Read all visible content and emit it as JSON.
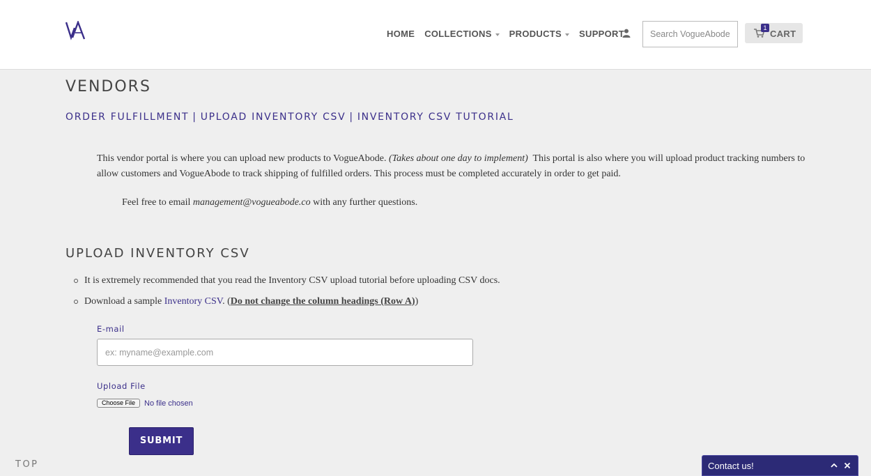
{
  "header": {
    "logo_alt": "VA",
    "nav": [
      {
        "label": "HOME",
        "dropdown": false
      },
      {
        "label": "COLLECTIONS",
        "dropdown": true
      },
      {
        "label": "PRODUCTS",
        "dropdown": true
      },
      {
        "label": "SUPPORT",
        "dropdown": false
      }
    ],
    "search_placeholder": "Search VogueAbode...",
    "cart": {
      "count": "1",
      "label": "CART"
    }
  },
  "page": {
    "title": "VENDORS",
    "subnav": [
      "ORDER FULFILLMENT",
      "UPLOAD INVENTORY CSV",
      "INVENTORY CSV TUTORIAL"
    ],
    "subnav_separator": "|",
    "intro_part1": "This vendor portal is where you can upload new products to VogueAbode.",
    "intro_italic": "(Takes about one day to implement)",
    "intro_part2": "This portal is also where you will upload product tracking numbers to allow customers and VogueAbode to track shipping of fulfilled orders. This process must be completed accurately in order to get paid.",
    "contact_prefix": "Feel free to email",
    "contact_email": "management@vogueabode.co",
    "contact_suffix": "with any further questions."
  },
  "upload": {
    "title": "UPLOAD INVENTORY CSV",
    "bullet1": "It is extremely recommended that you read the Inventory CSV upload tutorial before uploading CSV docs.",
    "bullet2_prefix": "Download a sample",
    "bullet2_link": "Inventory CSV",
    "bullet2_mid": ". (",
    "bullet2_warning": "Do not change the column headings (Row A)",
    "bullet2_end": ")",
    "email_label": "E-mail",
    "email_placeholder": "ex: myname@example.com",
    "file_label": "Upload File",
    "file_button": "Choose File",
    "file_status": "No file chosen",
    "submit": "SUBMIT"
  },
  "footer": {
    "top_link": "TOP",
    "contact_widget": "Contact us!"
  },
  "colors": {
    "brand": "#3b2f8a",
    "widget": "#2c2a76",
    "background": "#efefef"
  },
  "icons": [
    "va-logo-icon",
    "user-icon",
    "cart-icon",
    "chevron-up-icon",
    "close-icon"
  ]
}
